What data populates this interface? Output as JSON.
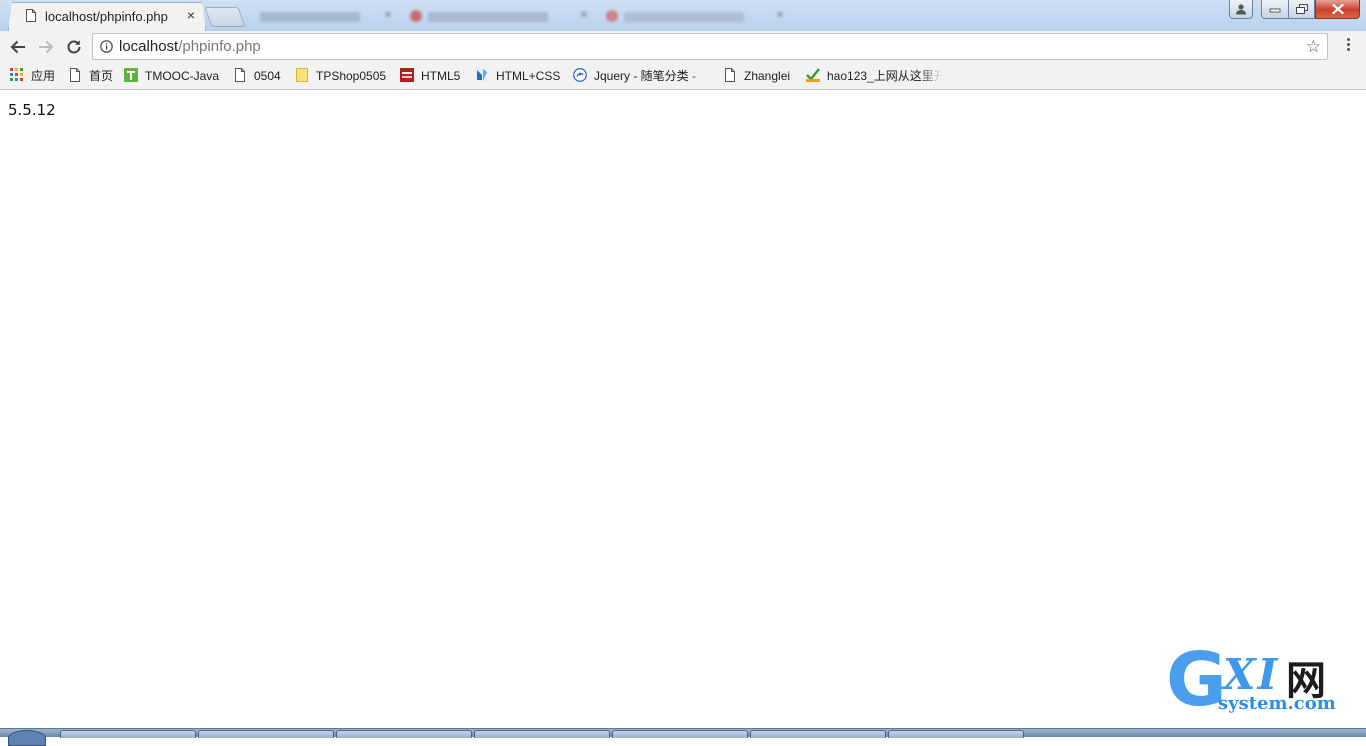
{
  "tabs": [
    {
      "label": "localhost/phpinfo.php",
      "active": true
    },
    {
      "label": "",
      "active": false,
      "blurred": true
    },
    {
      "label": "",
      "active": false,
      "blurred": true
    },
    {
      "label": "",
      "active": false,
      "blurred": true
    }
  ],
  "toolbar": {
    "url_host": "localhost",
    "url_path": "/phpinfo.php"
  },
  "bookmarks": [
    {
      "label": "应用",
      "icon": "apps-grid-icon"
    },
    {
      "label": "首页",
      "icon": "page-icon"
    },
    {
      "label": "TMOOC-Java",
      "icon": "tmooc-icon"
    },
    {
      "label": "0504",
      "icon": "page-icon"
    },
    {
      "label": "TPShop0505",
      "icon": "folder-icon"
    },
    {
      "label": "HTML5",
      "icon": "html5-site-icon"
    },
    {
      "label": "HTML+CSS",
      "icon": "html-css-site-icon"
    },
    {
      "label": "Jquery - 随笔分类 - ",
      "icon": "jquery-site-icon"
    },
    {
      "label": "Zhanglei",
      "icon": "page-icon"
    },
    {
      "label": "hao123_上网从这里开",
      "icon": "hao123-icon"
    }
  ],
  "content": {
    "text": "5.5.12"
  },
  "watermark": {
    "big_letter": "G",
    "letters": "XI",
    "cn_char": "网",
    "site": "system.com"
  },
  "colors": {
    "watermark_blue": "#2b8ee8",
    "close_red": "#c7402a"
  }
}
